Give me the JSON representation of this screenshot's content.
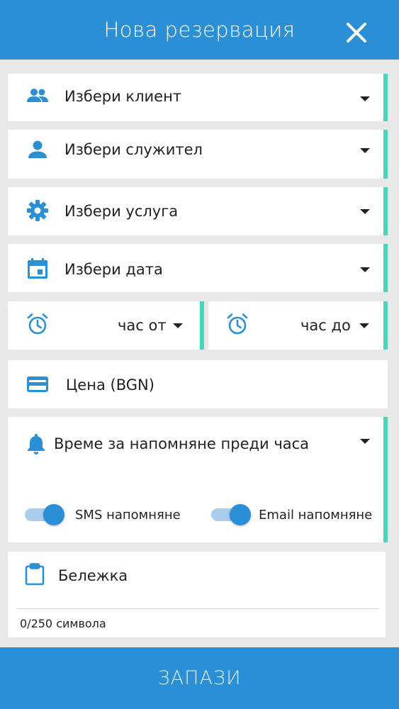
{
  "header": {
    "title": "Нова резервация"
  },
  "fields": {
    "client": "Избери клиент",
    "employee": "Избери служител",
    "service": "Избери услуга",
    "date": "Избери дата",
    "time_from": "час от",
    "time_to": "час до",
    "price": "Цена (BGN)",
    "reminder": "Време за напомняне преди часа"
  },
  "toggles": {
    "sms": {
      "label": "SMS напомняне",
      "on": true
    },
    "email": {
      "label": "Email напомняне",
      "on": true
    }
  },
  "note": {
    "label": "Бележка",
    "counter": "0/250 символа"
  },
  "save": {
    "label": "ЗАПАЗИ"
  },
  "colors": {
    "primary": "#2b8fd6",
    "accent": "#4cd3bb",
    "background": "#e8e8e8",
    "icon": "#2b8fd6"
  }
}
